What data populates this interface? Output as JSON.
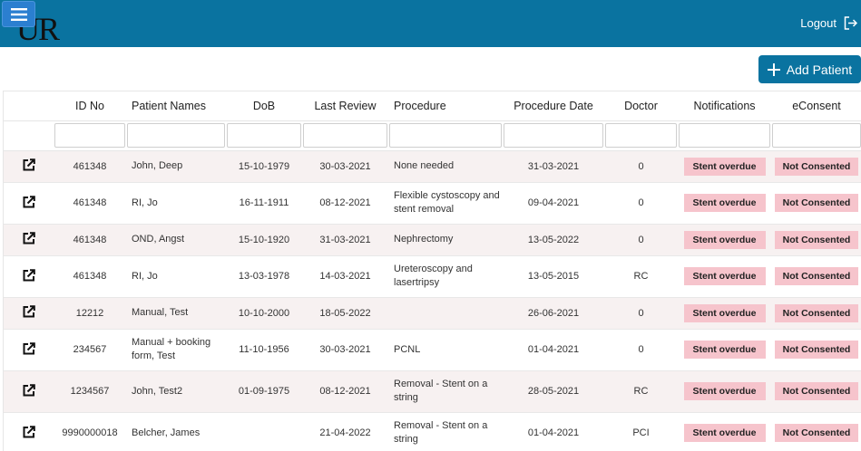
{
  "header": {
    "logo_text": "UR",
    "logout_label": "Logout"
  },
  "actions": {
    "add_patient_label": "Add Patient"
  },
  "table": {
    "columns": [
      "",
      "ID No",
      "Patient Names",
      "DoB",
      "Last Review",
      "Procedure",
      "Procedure Date",
      "Doctor",
      "Notifications",
      "eConsent"
    ],
    "rows": [
      {
        "id": "461348",
        "name": "John, Deep",
        "dob": "15-10-1979",
        "last_review": "30-03-2021",
        "procedure": "None needed",
        "procedure_date": "31-03-2021",
        "doctor": "0",
        "notification": "Stent overdue",
        "consent": "Not Consented"
      },
      {
        "id": "461348",
        "name": "RI, Jo",
        "dob": "16-11-1911",
        "last_review": "08-12-2021",
        "procedure": "Flexible cystoscopy and stent removal",
        "procedure_date": "09-04-2021",
        "doctor": "0",
        "notification": "Stent overdue",
        "consent": "Not Consented"
      },
      {
        "id": "461348",
        "name": "OND, Angst",
        "dob": "15-10-1920",
        "last_review": "31-03-2021",
        "procedure": "Nephrectomy",
        "procedure_date": "13-05-2022",
        "doctor": "0",
        "notification": "Stent overdue",
        "consent": "Not Consented"
      },
      {
        "id": "461348",
        "name": "RI, Jo",
        "dob": "13-03-1978",
        "last_review": "14-03-2021",
        "procedure": "Ureteroscopy and lasertripsy",
        "procedure_date": "13-05-2015",
        "doctor": "RC",
        "notification": "Stent overdue",
        "consent": "Not Consented"
      },
      {
        "id": "12212",
        "name": "Manual, Test",
        "dob": "10-10-2000",
        "last_review": "18-05-2022",
        "procedure": "",
        "procedure_date": "26-06-2021",
        "doctor": "0",
        "notification": "Stent overdue",
        "consent": "Not Consented"
      },
      {
        "id": "234567",
        "name": "Manual + booking form, Test",
        "dob": "11-10-1956",
        "last_review": "30-03-2021",
        "procedure": "PCNL",
        "procedure_date": "01-04-2021",
        "doctor": "0",
        "notification": "Stent overdue",
        "consent": "Not Consented"
      },
      {
        "id": "1234567",
        "name": "John, Test2",
        "dob": "01-09-1975",
        "last_review": "08-12-2021",
        "procedure": "Removal - Stent on a string",
        "procedure_date": "28-05-2021",
        "doctor": "RC",
        "notification": "Stent overdue",
        "consent": "Not Consented"
      },
      {
        "id": "9990000018",
        "name": "Belcher, James",
        "dob": "",
        "last_review": "21-04-2022",
        "procedure": "Removal - Stent on a string",
        "procedure_date": "01-04-2021",
        "doctor": "PCI",
        "notification": "Stent overdue",
        "consent": "Not Consented"
      }
    ]
  }
}
